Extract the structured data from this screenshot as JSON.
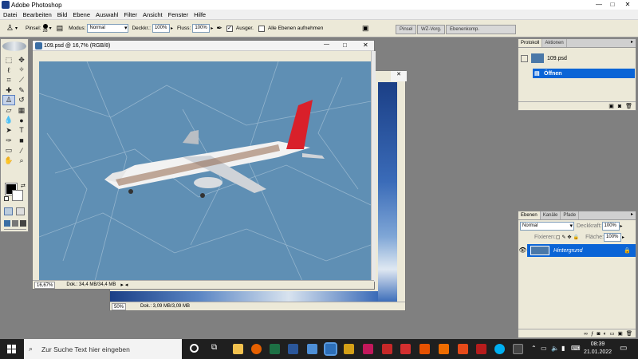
{
  "app": {
    "title": "Adobe Photoshop",
    "min": "—",
    "max": "□",
    "close": "✕"
  },
  "menu": [
    "Datei",
    "Bearbeiten",
    "Bild",
    "Ebene",
    "Auswahl",
    "Filter",
    "Ansicht",
    "Fenster",
    "Hilfe"
  ],
  "options": {
    "brush_label": "Pinsel:",
    "brush_size": "28",
    "mode_label": "Modus:",
    "mode_value": "Normal",
    "opacity_label": "Deckkr.:",
    "opacity_value": "100%",
    "flow_label": "Fluss:",
    "flow_value": "100%",
    "aligned_label": "Ausger.",
    "all_layers_label": "Alle Ebenen aufnehmen"
  },
  "palette_well": [
    "Pinsel",
    "WZ-Vorg.",
    "Ebenenkomp."
  ],
  "doc_main": {
    "title": "109.psd @ 16,7% (RGB/8)",
    "zoom": "16,67%",
    "doc_info": "Dok.: 34,4 MB/34,4 MB",
    "min": "—",
    "max": "□",
    "close": "✕"
  },
  "doc_back": {
    "zoom": "50%",
    "doc_info": "Dok.: 3,09 MB/3,09 MB"
  },
  "history": {
    "tabs": [
      "Protokoll",
      "Aktionen"
    ],
    "snapshot": "109.psd",
    "state": "Öffnen"
  },
  "layers": {
    "tabs": [
      "Ebenen",
      "Kanäle",
      "Pfade"
    ],
    "blend_mode": "Normal",
    "opacity_label": "Deckkraft:",
    "opacity_value": "100%",
    "lock_label": "Fixieren:",
    "fill_label": "Fläche:",
    "fill_value": "100%",
    "layer_name": "Hintergrund"
  },
  "taskbar": {
    "search_placeholder": "Zur Suche Text hier eingeben",
    "time": "08:39",
    "date": "21.01.2022"
  },
  "colors": {
    "accent": "#0a64d6",
    "task_bg": "#1f1f1f"
  }
}
